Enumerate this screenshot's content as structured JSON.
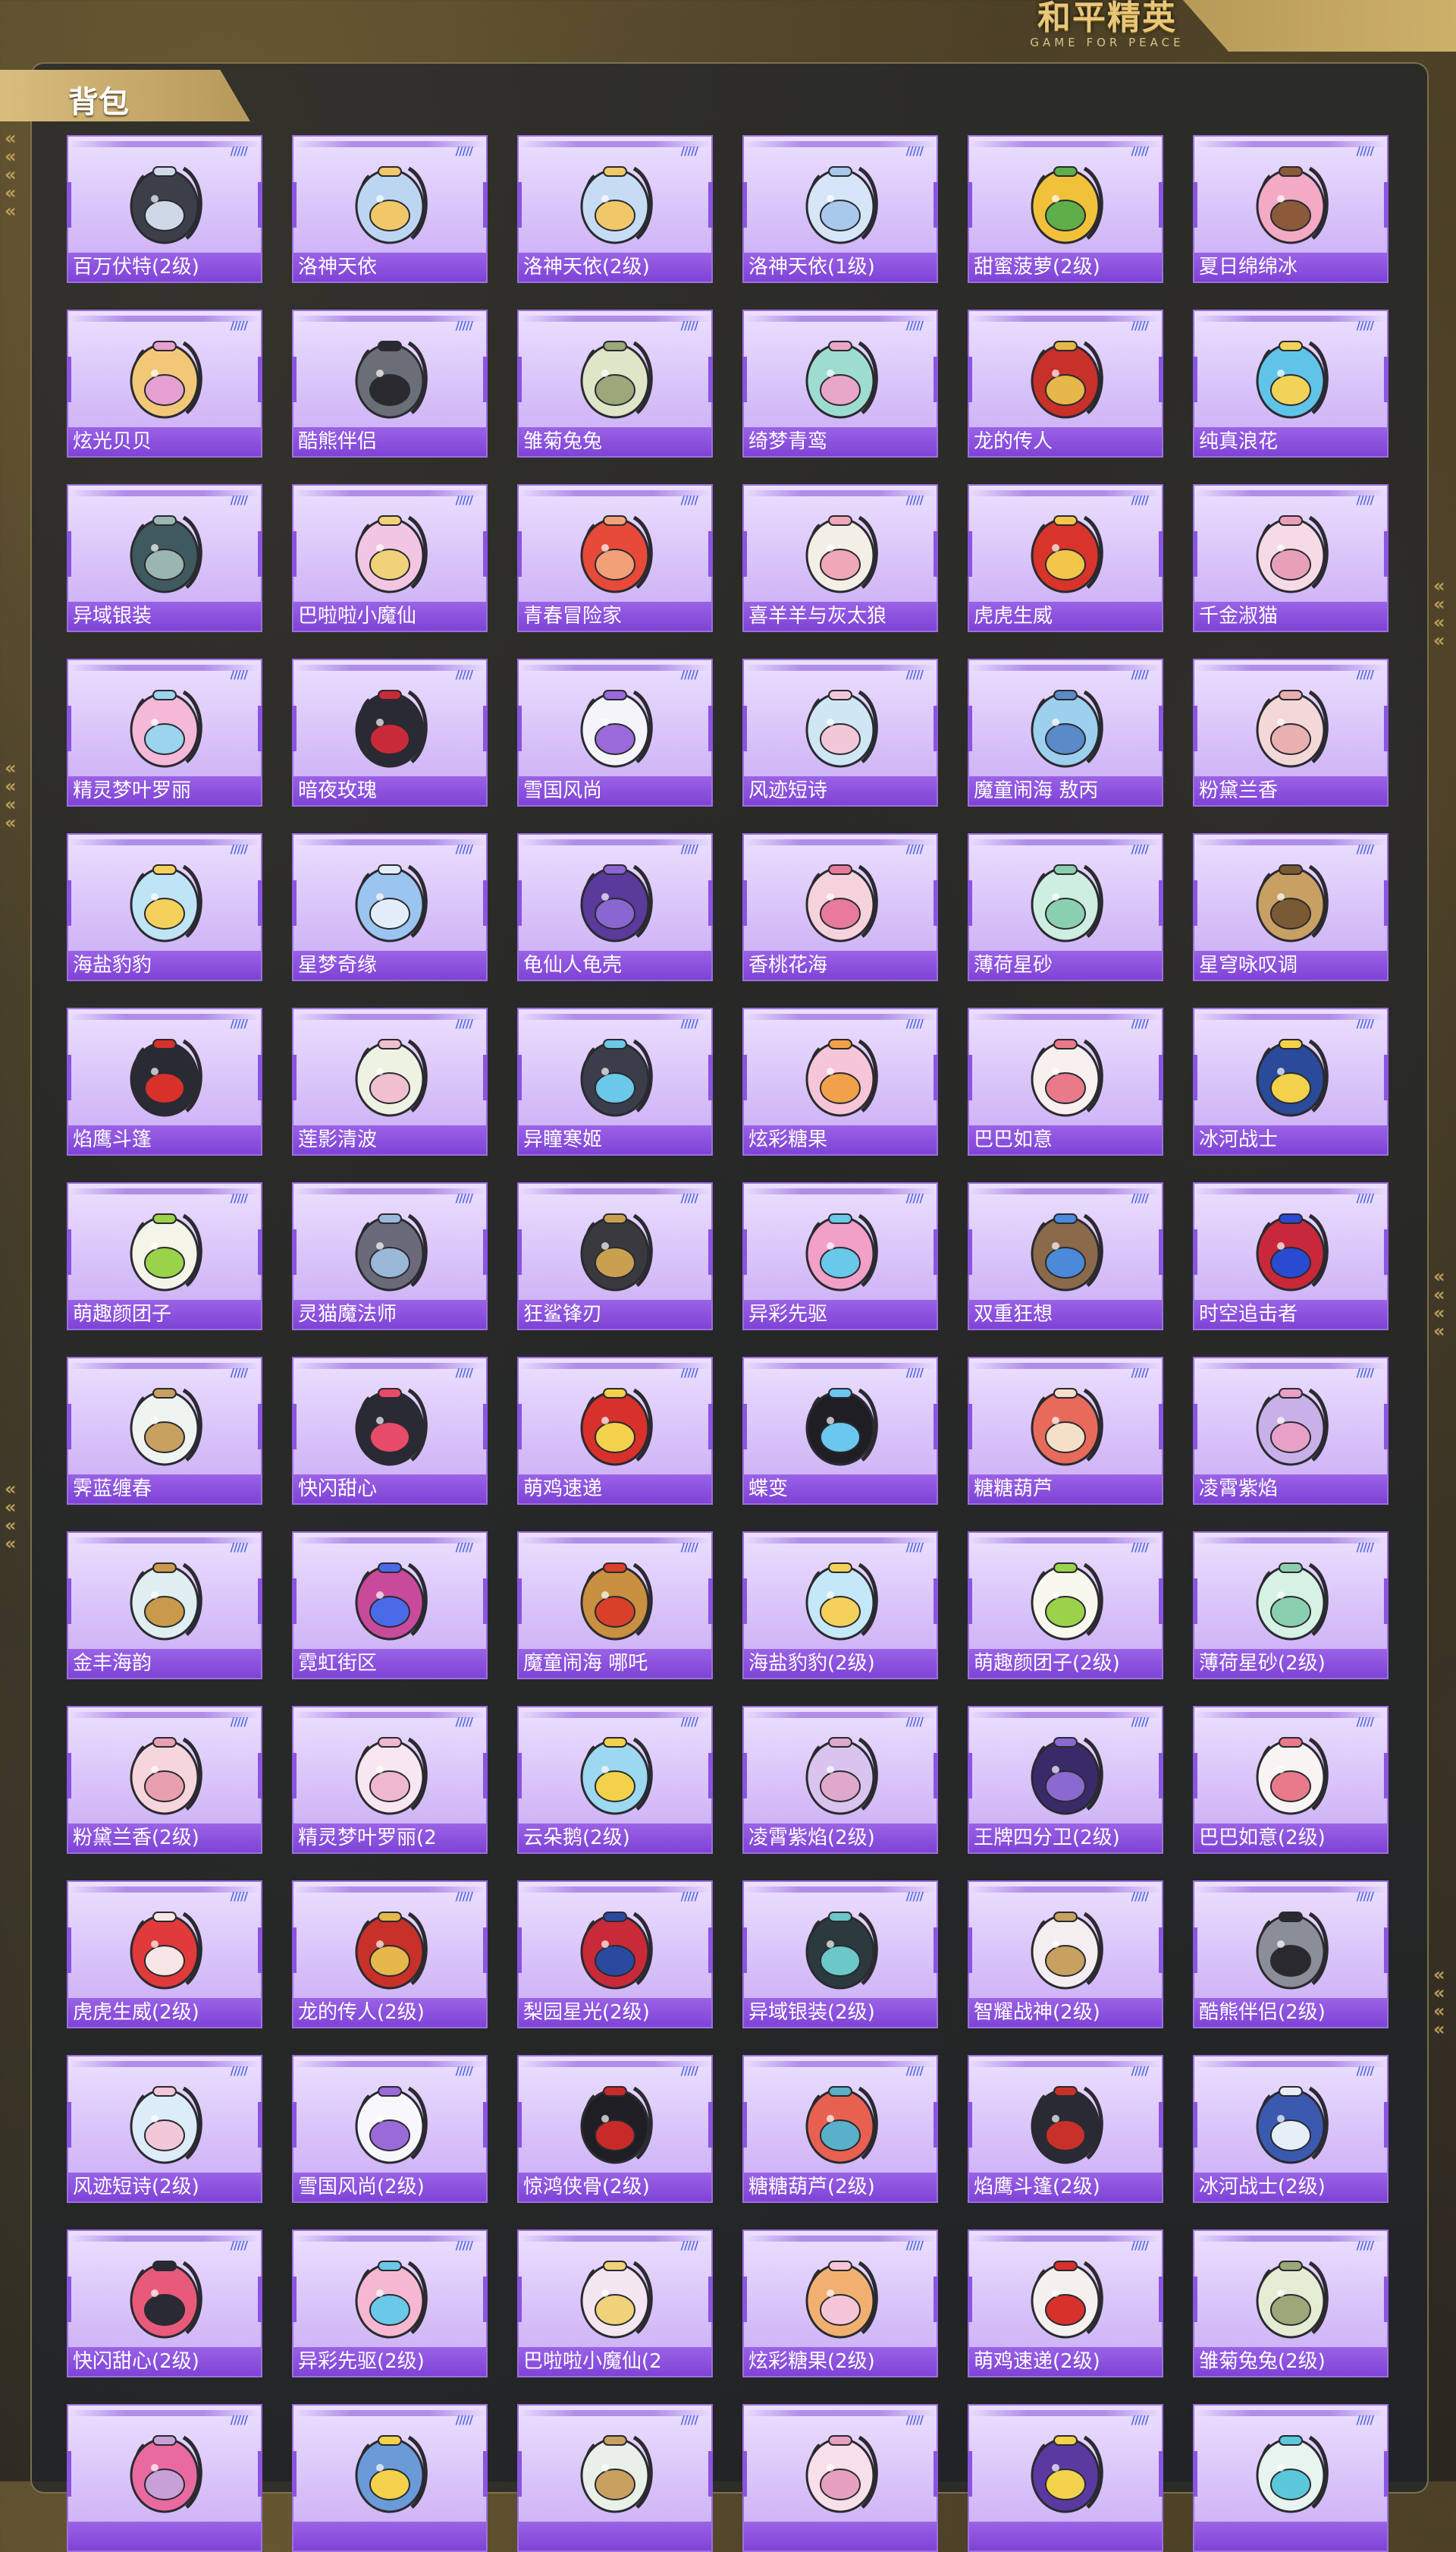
{
  "brand": {
    "cn": "和平精英",
    "en": "GAME FOR PEACE"
  },
  "header": {
    "title": "背包"
  },
  "colors": {
    "card_bg": "#d6bff8",
    "label_bg": "#8a4fe0",
    "panel_border": "#bfa86e",
    "quality_bars": "#4f68e0"
  },
  "items": [
    {
      "label": "百万伏特(2级)",
      "color": "#3a3f4a",
      "accent": "#cfd8e6"
    },
    {
      "label": "洛神天依",
      "color": "#bcd6f2",
      "accent": "#f0c86a"
    },
    {
      "label": "洛神天依(2级)",
      "color": "#c6dcf5",
      "accent": "#f0c86a"
    },
    {
      "label": "洛神天依(1级)",
      "color": "#d6e6f8",
      "accent": "#a8c8ec"
    },
    {
      "label": "甜蜜菠萝(2级)",
      "color": "#f2c13a",
      "accent": "#5fae4a"
    },
    {
      "label": "夏日绵绵冰",
      "color": "#f4a9c4",
      "accent": "#8a5a3a"
    },
    {
      "label": "炫光贝贝",
      "color": "#f2c878",
      "accent": "#e6a0d0"
    },
    {
      "label": "酷熊伴侣",
      "color": "#6a6e76",
      "accent": "#2a2a2e"
    },
    {
      "label": "雏菊兔兔",
      "color": "#dfe6c8",
      "accent": "#9aa87a"
    },
    {
      "label": "绮梦青鸾",
      "color": "#9fdcd0",
      "accent": "#e8a6c8"
    },
    {
      "label": "龙的传人",
      "color": "#c8302a",
      "accent": "#e6b84a"
    },
    {
      "label": "纯真浪花",
      "color": "#5fc4e8",
      "accent": "#f2d35a"
    },
    {
      "label": "异域银装",
      "color": "#3e5a5e",
      "accent": "#9ab6b0"
    },
    {
      "label": "巴啦啦小魔仙",
      "color": "#f2c6e2",
      "accent": "#f0d27a"
    },
    {
      "label": "青春冒险家",
      "color": "#e84a3a",
      "accent": "#f2a078"
    },
    {
      "label": "喜羊羊与灰太狼",
      "color": "#f4efe6",
      "accent": "#f0a8b8"
    },
    {
      "label": "虎虎生威",
      "color": "#d8342a",
      "accent": "#f2c64a"
    },
    {
      "label": "千金淑猫",
      "color": "#f6dbe6",
      "accent": "#e8a0b8"
    },
    {
      "label": "精灵梦叶罗丽",
      "color": "#f4b8d8",
      "accent": "#9cd4ee"
    },
    {
      "label": "暗夜玫瑰",
      "color": "#2a2a34",
      "accent": "#c82a3a"
    },
    {
      "label": "雪国风尚",
      "color": "#f4f4fa",
      "accent": "#9a6ad8"
    },
    {
      "label": "风迹短诗",
      "color": "#cfe6f4",
      "accent": "#f2c8d8"
    },
    {
      "label": "魔童闹海 敖丙",
      "color": "#9cd0ee",
      "accent": "#5a8ac8"
    },
    {
      "label": "粉黛兰香",
      "color": "#f4d8d8",
      "accent": "#e8b0b0"
    },
    {
      "label": "海盐豹豹",
      "color": "#bfe4f6",
      "accent": "#f4d15a"
    },
    {
      "label": "星梦奇缘",
      "color": "#9cc4f0",
      "accent": "#e4eefa"
    },
    {
      "label": "龟仙人龟壳",
      "color": "#5a3a9a",
      "accent": "#8a66d0"
    },
    {
      "label": "香桃花海",
      "color": "#f6d2dc",
      "accent": "#e87a9a"
    },
    {
      "label": "薄荷星砂",
      "color": "#cdeee0",
      "accent": "#8ad0b0"
    },
    {
      "label": "星穹咏叹调",
      "color": "#c8a064",
      "accent": "#7a5a34"
    },
    {
      "label": "焰鹰斗篷",
      "color": "#2a2a34",
      "accent": "#d8302a"
    },
    {
      "label": "莲影清波",
      "color": "#eef2e2",
      "accent": "#f0c0d0"
    },
    {
      "label": "异瞳寒姬",
      "color": "#3a3e4a",
      "accent": "#6ac8e8"
    },
    {
      "label": "炫彩糖果",
      "color": "#f6c6d8",
      "accent": "#f2a04a"
    },
    {
      "label": "巴巴如意",
      "color": "#f8f0ee",
      "accent": "#e87a8a"
    },
    {
      "label": "冰河战士",
      "color": "#2a4a9a",
      "accent": "#f2d24a"
    },
    {
      "label": "萌趣颜团子",
      "color": "#f4f4e8",
      "accent": "#9ad24a"
    },
    {
      "label": "灵猫魔法师",
      "color": "#6a6a7a",
      "accent": "#9ab8d8"
    },
    {
      "label": "狂鲨锋刃",
      "color": "#3a3a3e",
      "accent": "#c8a050"
    },
    {
      "label": "异彩先驱",
      "color": "#f2a0c8",
      "accent": "#6ac8e8"
    },
    {
      "label": "双重狂想",
      "color": "#8a6a4a",
      "accent": "#4a8ad8"
    },
    {
      "label": "时空追击者",
      "color": "#c8283a",
      "accent": "#2a4ad0"
    },
    {
      "label": "霁蓝缠春",
      "color": "#eef4f0",
      "accent": "#c8a060"
    },
    {
      "label": "快闪甜心",
      "color": "#2a2a34",
      "accent": "#e84a6a"
    },
    {
      "label": "萌鸡速递",
      "color": "#d8302a",
      "accent": "#f2d24a"
    },
    {
      "label": "蝶变",
      "color": "#1e1e24",
      "accent": "#6ac8f0"
    },
    {
      "label": "糖糖葫芦",
      "color": "#e86a5a",
      "accent": "#f4e0c8"
    },
    {
      "label": "凌霄紫焰",
      "color": "#c8b0e8",
      "accent": "#e8a0c8"
    },
    {
      "label": "金丰海韵",
      "color": "#dfeef0",
      "accent": "#c89a4a"
    },
    {
      "label": "霓虹街区",
      "color": "#c84a9a",
      "accent": "#4a6ae8"
    },
    {
      "label": "魔童闹海 哪吒",
      "color": "#c89040",
      "accent": "#d8402a"
    },
    {
      "label": "海盐豹豹(2级)",
      "color": "#c4e8f8",
      "accent": "#f4d15a"
    },
    {
      "label": "萌趣颜团子(2级)",
      "color": "#f8f8ee",
      "accent": "#9ad24a"
    },
    {
      "label": "薄荷星砂(2级)",
      "color": "#d6f2e4",
      "accent": "#8ad0b0"
    },
    {
      "label": "粉黛兰香(2级)",
      "color": "#f6d6dc",
      "accent": "#e8a0b0"
    },
    {
      "label": "精灵梦叶罗丽(2",
      "color": "#f8e6f0",
      "accent": "#f0b8d0"
    },
    {
      "label": "云朵鹅(2级)",
      "color": "#9cd8f0",
      "accent": "#f2d24a"
    },
    {
      "label": "凌霄紫焰(2级)",
      "color": "#d8c4ee",
      "accent": "#e0a8cc"
    },
    {
      "label": "王牌四分卫(2级)",
      "color": "#3a2a6a",
      "accent": "#8a6ad0"
    },
    {
      "label": "巴巴如意(2级)",
      "color": "#f8f4f4",
      "accent": "#e87a8a"
    },
    {
      "label": "虎虎生威(2级)",
      "color": "#e03a3a",
      "accent": "#f8e6e6"
    },
    {
      "label": "龙的传人(2级)",
      "color": "#c8302a",
      "accent": "#e6b84a"
    },
    {
      "label": "梨园星光(2级)",
      "color": "#c82a3a",
      "accent": "#2a4aa0"
    },
    {
      "label": "异域银装(2级)",
      "color": "#2a3a3e",
      "accent": "#6ac8c8"
    },
    {
      "label": "智耀战神(2级)",
      "color": "#f4eef0",
      "accent": "#c8a060"
    },
    {
      "label": "酷熊伴侣(2级)",
      "color": "#8a8e98",
      "accent": "#2a2a2e"
    },
    {
      "label": "风迹短诗(2级)",
      "color": "#dcecf8",
      "accent": "#f2c8d8"
    },
    {
      "label": "雪国风尚(2级)",
      "color": "#f8f8fc",
      "accent": "#9a6ad8"
    },
    {
      "label": "惊鸿侠骨(2级)",
      "color": "#1e1e24",
      "accent": "#c82a2a"
    },
    {
      "label": "糖糖葫芦(2级)",
      "color": "#e86050",
      "accent": "#5ab0c8"
    },
    {
      "label": "焰鹰斗篷(2级)",
      "color": "#2a2a34",
      "accent": "#c8302a"
    },
    {
      "label": "冰河战士(2级)",
      "color": "#3a5ab0",
      "accent": "#e6eef8"
    },
    {
      "label": "快闪甜心(2级)",
      "color": "#e85a7a",
      "accent": "#2a2a34"
    },
    {
      "label": "异彩先驱(2级)",
      "color": "#f6b8d0",
      "accent": "#6ac8e8"
    },
    {
      "label": "巴啦啦小魔仙(2",
      "color": "#f4e6f0",
      "accent": "#f0d27a"
    },
    {
      "label": "炫彩糖果(2级)",
      "color": "#f2b070",
      "accent": "#f6c6d8"
    },
    {
      "label": "萌鸡速递(2级)",
      "color": "#f4f0ee",
      "accent": "#d8302a"
    },
    {
      "label": "雏菊兔兔(2级)",
      "color": "#e4ecd4",
      "accent": "#9aa87a"
    },
    {
      "label": "",
      "color": "#e86aa0",
      "accent": "#c8a0d8"
    },
    {
      "label": "",
      "color": "#6a9ad8",
      "accent": "#f2d24a"
    },
    {
      "label": "",
      "color": "#e8f0e8",
      "accent": "#c8a060"
    },
    {
      "label": "",
      "color": "#f8e0ea",
      "accent": "#e8a0c0"
    },
    {
      "label": "",
      "color": "#5a3aa0",
      "accent": "#f2d24a"
    },
    {
      "label": "",
      "color": "#e8f4f0",
      "accent": "#5ac8d8"
    }
  ]
}
